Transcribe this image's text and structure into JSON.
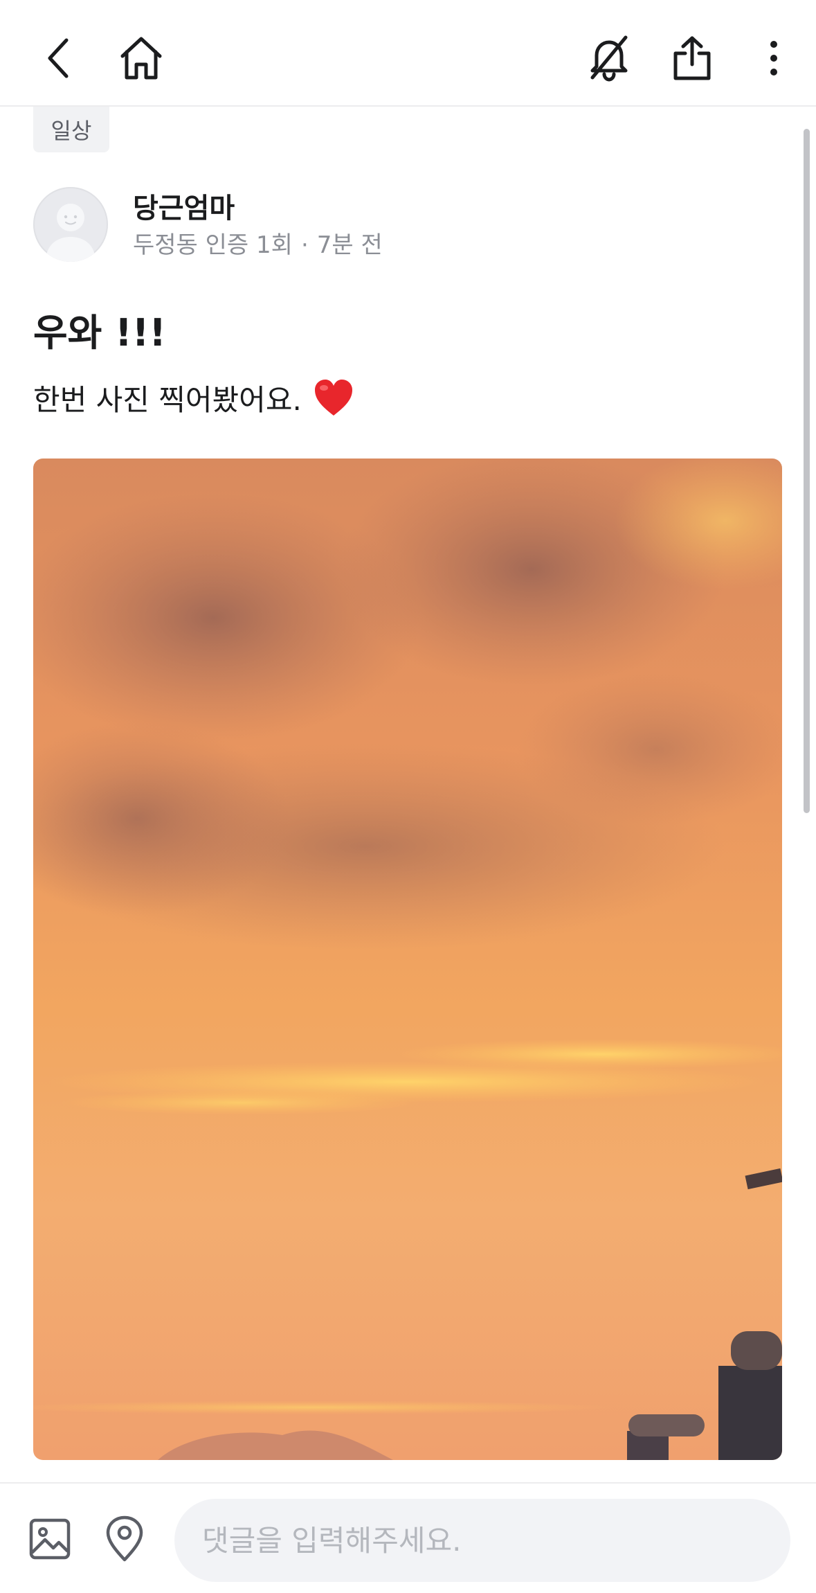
{
  "header": {
    "back_icon": "back-arrow-icon",
    "home_icon": "home-icon",
    "notify_icon": "bell-off-icon",
    "share_icon": "share-icon",
    "more_icon": "more-vertical-icon"
  },
  "post": {
    "category": "일상",
    "author": {
      "nickname": "당근엄마",
      "neighborhood_verification": "두정동 인증 1회",
      "separator": "·",
      "time_ago": "7분 전"
    },
    "title": "우와 !!!",
    "body": "한번 사진 찍어봤어요.",
    "body_emoji_icon": "red-heart-icon",
    "photo": "sunset-sky-photo"
  },
  "comment_bar": {
    "gallery_icon": "image-icon",
    "location_icon": "location-pin-icon",
    "placeholder": "댓글을 입력해주세요."
  },
  "colors": {
    "text_primary": "#1b1c1e",
    "text_secondary": "#8b8e95",
    "tag_background": "#f1f2f4",
    "input_background": "#f2f3f6",
    "heart": "#e8262c"
  }
}
